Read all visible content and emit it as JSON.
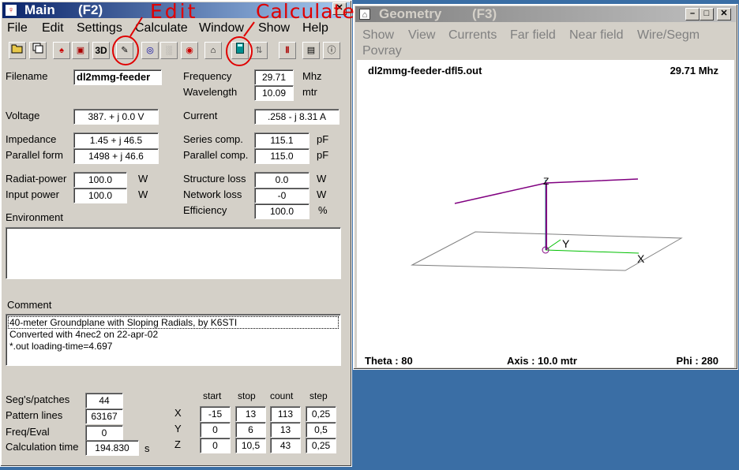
{
  "main": {
    "title": "Main",
    "hotkey": "(F2)",
    "menu": [
      "File",
      "Edit",
      "Settings",
      "Calculate",
      "Window",
      "Show",
      "Help"
    ],
    "toolbar_icons": [
      "open-icon",
      "copy-icon",
      "bulb-icon",
      "cube-icon",
      "3d-icon",
      "edit-icon",
      "radiation-icon",
      "pattern-icon",
      "target-icon",
      "geometry-icon",
      "calculate-icon",
      "swap-icon",
      "settings-icon",
      "book-icon",
      "help-icon"
    ],
    "toolbar_3d_label": "3D",
    "filename_label": "Filename",
    "filename_value": "dl2mmg-feeder",
    "frequency_label": "Frequency",
    "frequency_value": "29.71",
    "frequency_unit": "Mhz",
    "wavelength_label": "Wavelength",
    "wavelength_value": "10.09",
    "wavelength_unit": "mtr",
    "voltage_label": "Voltage",
    "voltage_value": "387. + j 0.0 V",
    "current_label": "Current",
    "current_value": ".258 - j 8.31 A",
    "impedance_label": "Impedance",
    "impedance_value": "1.45 + j 46.5",
    "parallel_form_label": "Parallel form",
    "parallel_form_value": "1498 + j 46.6",
    "series_comp_label": "Series comp.",
    "series_comp_value": "115.1",
    "series_comp_unit": "pF",
    "parallel_comp_label": "Parallel comp.",
    "parallel_comp_value": "115.0",
    "parallel_comp_unit": "pF",
    "radiat_power_label": "Radiat-power",
    "radiat_power_value": "100.0",
    "radiat_power_unit": "W",
    "input_power_label": "Input power",
    "input_power_value": "100.0",
    "input_power_unit": "W",
    "structure_loss_label": "Structure loss",
    "structure_loss_value": "0.0",
    "structure_loss_unit": "W",
    "network_loss_label": "Network loss",
    "network_loss_value": "-0",
    "network_loss_unit": "W",
    "efficiency_label": "Efficiency",
    "efficiency_value": "100.0",
    "efficiency_unit": "%",
    "environment_label": "Environment",
    "comment_label": "Comment",
    "comment_lines": [
      "40-meter Groundplane with Sloping Radials, by K6STI",
      "Converted with 4nec2 on 22-apr-02",
      "*.out loading-time=4.697"
    ],
    "segs_label": "Seg's/patches",
    "segs_value": "44",
    "pattern_lines_label": "Pattern lines",
    "pattern_lines_value": "63167",
    "freq_eval_label": "Freq/Eval",
    "freq_eval_value": "0",
    "calc_time_label": "Calculation time",
    "calc_time_value": "194.830",
    "calc_time_unit": "s",
    "grid_headers": [
      "start",
      "stop",
      "count",
      "step"
    ],
    "grid_rows": [
      {
        "axis": "X",
        "start": "-15",
        "stop": "13",
        "count": "113",
        "step": "0,25"
      },
      {
        "axis": "Y",
        "start": "0",
        "stop": "6",
        "count": "13",
        "step": "0,5"
      },
      {
        "axis": "Z",
        "start": "0",
        "stop": "10,5",
        "count": "43",
        "step": "0,25"
      }
    ]
  },
  "annotations": {
    "edit": "Edit",
    "calculate": "Calculate"
  },
  "geometry": {
    "title": "Geometry",
    "hotkey": "(F3)",
    "menu": [
      "Show",
      "View",
      "Currents",
      "Far field",
      "Near field",
      "Wire/Segm",
      "Povray"
    ],
    "filename": "dl2mmg-feeder-dfl5.out",
    "frequency": "29.71 Mhz",
    "theta": "Theta : 80",
    "axis": "Axis : 10.0 mtr",
    "phi": "Phi : 280",
    "axis_labels": {
      "x": "X",
      "y": "Y",
      "z": "Z"
    }
  },
  "colors": {
    "annotation": "#e00000",
    "title_active": "#0a246a",
    "wire": "#800080",
    "x_axis": "#00c000",
    "z_axis": "#008080"
  }
}
